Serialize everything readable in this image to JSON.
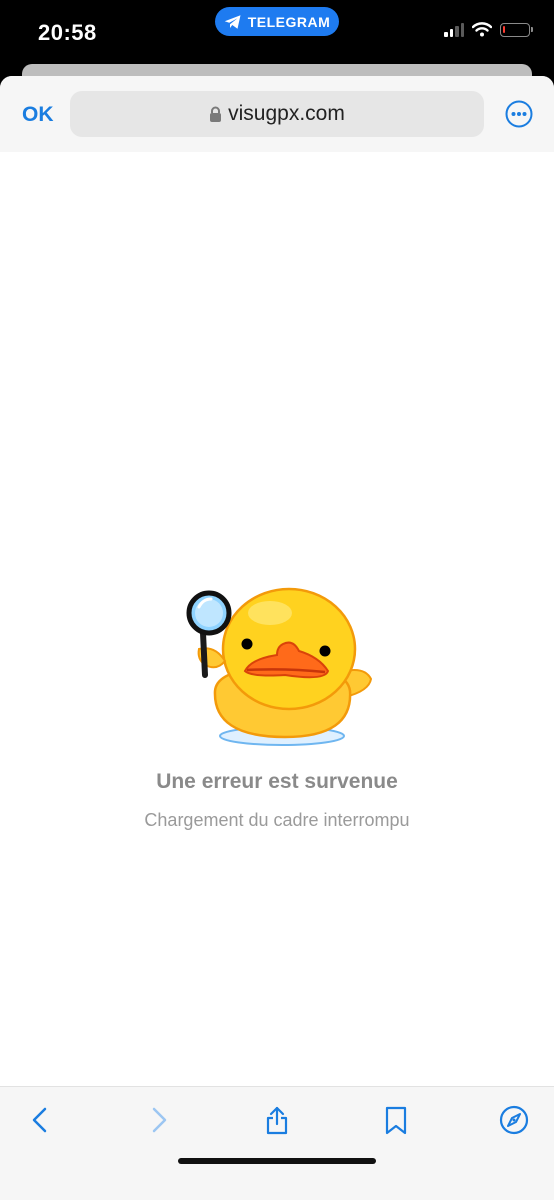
{
  "status_bar": {
    "time": "20:58",
    "pill_label": "TELEGRAM",
    "pill_color": "#1e7bf0",
    "icons": [
      "telegram-icon",
      "signal-icon",
      "wifi-icon",
      "battery-icon"
    ],
    "battery_level": 0.08
  },
  "browser": {
    "ok_label": "OK",
    "url": "visugpx.com",
    "url_icon": "lock-icon",
    "more_icon": "more-icon",
    "accent_color": "#1a7de0"
  },
  "content": {
    "illustration": "duck-with-magnifying-glass",
    "error_title": "Une erreur est survenue",
    "error_subtitle": "Chargement du cadre interrompu"
  },
  "toolbar": {
    "buttons": [
      {
        "name": "back",
        "icon": "chevron-left-icon",
        "enabled": true
      },
      {
        "name": "forward",
        "icon": "chevron-right-icon",
        "enabled": false
      },
      {
        "name": "share",
        "icon": "share-icon",
        "enabled": true
      },
      {
        "name": "bookmarks",
        "icon": "bookmark-icon",
        "enabled": true
      },
      {
        "name": "open-in-browser",
        "icon": "compass-icon",
        "enabled": true
      }
    ]
  }
}
